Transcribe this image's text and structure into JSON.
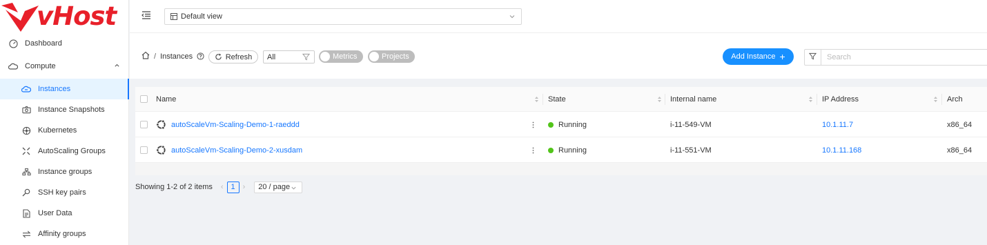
{
  "brand": {
    "name": "vHost",
    "color": "#e8202a"
  },
  "header": {
    "view_select": "Default view"
  },
  "sidebar": {
    "items": [
      {
        "label": "Dashboard",
        "icon": "dashboard-icon"
      },
      {
        "label": "Compute",
        "icon": "cloud-icon",
        "expanded": true
      },
      {
        "label": "Instances",
        "icon": "cloud-server-icon",
        "active": true
      },
      {
        "label": "Instance Snapshots",
        "icon": "camera-icon"
      },
      {
        "label": "Kubernetes",
        "icon": "kubernetes-icon"
      },
      {
        "label": "AutoScaling Groups",
        "icon": "expand-arrows-icon"
      },
      {
        "label": "Instance groups",
        "icon": "cluster-icon"
      },
      {
        "label": "SSH key pairs",
        "icon": "key-icon"
      },
      {
        "label": "User Data",
        "icon": "document-icon"
      },
      {
        "label": "Affinity groups",
        "icon": "swap-icon"
      }
    ]
  },
  "toolbar": {
    "breadcrumb": "Instances",
    "refresh_label": "Refresh",
    "filter_value": "All",
    "metrics_label": "Metrics",
    "projects_label": "Projects",
    "add_label": "Add Instance",
    "search_placeholder": "Search"
  },
  "table": {
    "columns": [
      "Name",
      "State",
      "Internal name",
      "IP Address",
      "Arch"
    ],
    "rows": [
      {
        "name": "autoScaleVm-Scaling-Demo-1-raeddd",
        "state": "Running",
        "internal_name": "i-11-549-VM",
        "ip": "10.1.11.7",
        "arch": "x86_64"
      },
      {
        "name": "autoScaleVm-Scaling-Demo-2-xusdam",
        "state": "Running",
        "internal_name": "i-11-551-VM",
        "ip": "10.1.11.168",
        "arch": "x86_64"
      }
    ]
  },
  "pagination": {
    "summary": "Showing 1-2 of 2 items",
    "current_page": "1",
    "page_size": "20 / page"
  },
  "colors": {
    "accent": "#1677ff",
    "running": "#52c41a"
  }
}
